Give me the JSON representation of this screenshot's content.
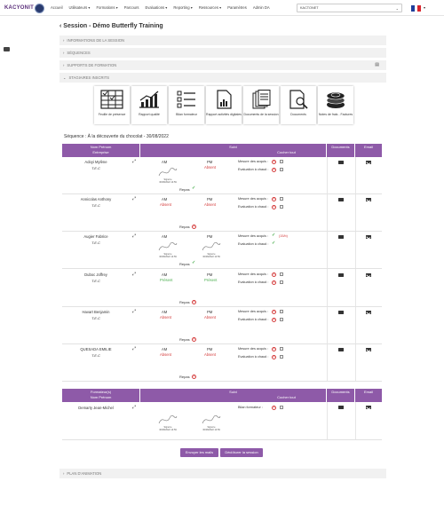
{
  "brand": {
    "name": "KACYONIT"
  },
  "nav": [
    "Accueil",
    "Utilisateurs ▾",
    "Formations ▾",
    "Parcours",
    "Evaluations ▾",
    "Reporting ▾",
    "Ressources ▾",
    "Paramètres",
    "Admin DA"
  ],
  "company": {
    "value": "KACTONET"
  },
  "page": {
    "title": "Session - Démo Butterfly Training"
  },
  "accordions": {
    "info": "INFORMATIONS DE LA SESSION",
    "sequences": "SÉQUENCES",
    "supports": "SUPPORTS DE FORMATION",
    "stagiaires": "STAGIAIRES INSCRITS",
    "plan": "PLAN D'ANIMATION"
  },
  "tiles": [
    {
      "label": "Feuille de présence",
      "icon": "attendance-sheet-icon"
    },
    {
      "label": "Rapport qualité",
      "icon": "growth-chart-icon"
    },
    {
      "label": "Bilan formateur",
      "icon": "checklist-icon"
    },
    {
      "label": "Rapport activités digitales",
      "icon": "document-chart-icon"
    },
    {
      "label": "Documents de la session",
      "icon": "documents-stack-icon"
    },
    {
      "label": "Documents",
      "icon": "search-document-icon"
    },
    {
      "label": "Notes de frais - Factures",
      "icon": "coins-icon"
    }
  ],
  "sequence": {
    "title": "Séquence : À la découverte du chocolat - 30/08/2022"
  },
  "table": {
    "col_name": "Nom Prénom",
    "col_company": "Entreprise",
    "col_suivi": "Suivi",
    "col_cocher": "Cocher tout",
    "col_docs": "Documents",
    "col_email": "Email",
    "am": "AM",
    "pm": "PM",
    "repas": "Repas",
    "mesure": "Mesure des acquis :",
    "evaluation": "Evaluation à chaud :",
    "signed": "Signé le",
    "signed_date": "30/08/2022 14:59"
  },
  "trainees": [
    {
      "name": "Adoyi Mylène",
      "company": "T.E.C",
      "am": "",
      "pm": "Absent",
      "note": ""
    },
    {
      "name": "Annicolas Anthony",
      "company": "T.E.C",
      "am": "Absent",
      "pm": "Absent",
      "note": ""
    },
    {
      "name": "Augier Fabrice",
      "company": "T.E.C",
      "am": "",
      "pm": "",
      "note": "(15/b)"
    },
    {
      "name": "Duboc Joffrey",
      "company": "T.E.C",
      "am": "Présent",
      "pm": "Présent",
      "note": ""
    },
    {
      "name": "Havart Benjamin",
      "company": "T.E.C",
      "am": "Absent",
      "pm": "Absent",
      "note": ""
    },
    {
      "name": "QUESADA EMILIE",
      "company": "T.E.C",
      "am": "Absent",
      "pm": "Absent",
      "note": ""
    }
  ],
  "trainers_table": {
    "col_title": "Formateur(s)",
    "col_name": "Nom Prénom",
    "bilan": "Bilan formateur :"
  },
  "trainers": [
    {
      "name": "Demarty Jean-Michel"
    }
  ],
  "buttons": {
    "send": "Envoyer les mails",
    "unlock": "Déclôturer la session"
  }
}
